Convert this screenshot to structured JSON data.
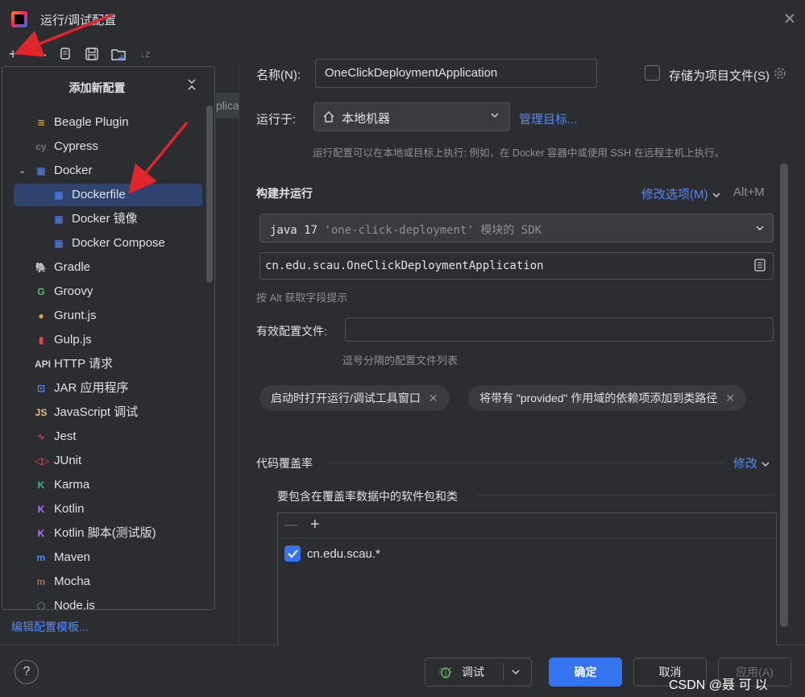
{
  "window": {
    "title": "运行/调试配置",
    "close_icon": "close-icon"
  },
  "toolbar": {
    "icons": [
      "add-icon",
      "remove-icon",
      "copy-icon",
      "save-icon",
      "new-folder-icon",
      "sort-icon"
    ]
  },
  "popup": {
    "title": "添加新配置",
    "items": [
      {
        "label": "Beagle Plugin",
        "icon": "beagle-icon",
        "color": "#c9a227"
      },
      {
        "label": "Cypress",
        "icon": "cypress-icon",
        "color": "#6f737a"
      },
      {
        "label": "Docker",
        "icon": "docker-icon",
        "color": "#548af7",
        "expanded": true
      },
      {
        "label": "Dockerfile",
        "icon": "docker-icon",
        "color": "#548af7",
        "selected": true
      },
      {
        "label": "Docker 镜像",
        "icon": "docker-icon",
        "color": "#548af7"
      },
      {
        "label": "Docker Compose",
        "icon": "docker-icon",
        "color": "#548af7"
      },
      {
        "label": "Gradle",
        "icon": "gradle-icon",
        "color": "#cfd1d6"
      },
      {
        "label": "Groovy",
        "icon": "groovy-icon",
        "color": "#5fb865"
      },
      {
        "label": "Grunt.js",
        "icon": "grunt-icon",
        "color": "#e0a33c"
      },
      {
        "label": "Gulp.js",
        "icon": "gulp-icon",
        "color": "#e0434a"
      },
      {
        "label": "HTTP 请求",
        "icon": "http-icon",
        "color": "#cfd1d6"
      },
      {
        "label": "JAR 应用程序",
        "icon": "jar-icon",
        "color": "#548af7"
      },
      {
        "label": "JavaScript 调试",
        "icon": "js-icon",
        "color": "#e5c07b"
      },
      {
        "label": "Jest",
        "icon": "jest-icon",
        "color": "#c2415d"
      },
      {
        "label": "JUnit",
        "icon": "junit-icon",
        "color": "#e0434a"
      },
      {
        "label": "Karma",
        "icon": "karma-icon",
        "color": "#3fb68b"
      },
      {
        "label": "Kotlin",
        "icon": "kotlin-icon",
        "color": "#a97bff"
      },
      {
        "label": "Kotlin 脚本(测试版)",
        "icon": "kotlin-icon",
        "color": "#a97bff"
      },
      {
        "label": "Maven",
        "icon": "maven-icon",
        "color": "#548af7"
      },
      {
        "label": "Mocha",
        "icon": "mocha-icon",
        "color": "#a0714f"
      },
      {
        "label": "Node.js",
        "icon": "nodejs-icon",
        "color": "#5fb865"
      }
    ],
    "edit_templates": "编辑配置模板..."
  },
  "behind_text": "plica",
  "form": {
    "name_label": "名称(N):",
    "name_value": "OneClickDeploymentApplication",
    "store_as_file": "存储为项目文件(S)",
    "run_on_label": "运行于:",
    "run_on_value": "本地机器",
    "manage_targets": "管理目标...",
    "run_on_hint": "运行配置可以在本地或目标上执行: 例如，在 Docker 容器中或使用 SSH 在远程主机上执行。",
    "build_run_title": "构建并运行",
    "modify_options": "修改选项(M)",
    "modify_shortcut": "Alt+M",
    "sdk_java": "java 17",
    "sdk_module": "'one-click-deployment'",
    "sdk_suffix": "模块的 SDK",
    "main_class": "cn.edu.scau.OneClickDeploymentApplication",
    "alt_hint": "按 Alt 获取字段提示",
    "active_profiles_label": "有效配置文件:",
    "active_profiles_value": "",
    "profiles_hint": "逗号分隔的配置文件列表",
    "chip1": "启动时打开运行/调试工具窗口",
    "chip2": "将带有 \"provided\" 作用域的依赖项添加到类路径"
  },
  "coverage": {
    "title": "代码覆盖率",
    "modify": "修改",
    "include_title": "要包含在覆盖率数据中的软件包和类",
    "entries": [
      {
        "checked": true,
        "pattern": "cn.edu.scau.*"
      }
    ]
  },
  "buttons": {
    "help": "?",
    "debug": "调试",
    "ok": "确定",
    "cancel": "取消",
    "apply": "应用(A)"
  },
  "watermark": "CSDN @聂 可 以",
  "colors": {
    "accent": "#3574f0",
    "link": "#548af7",
    "selected": "#2e436e",
    "annotation_arrow": "#e0262b"
  }
}
